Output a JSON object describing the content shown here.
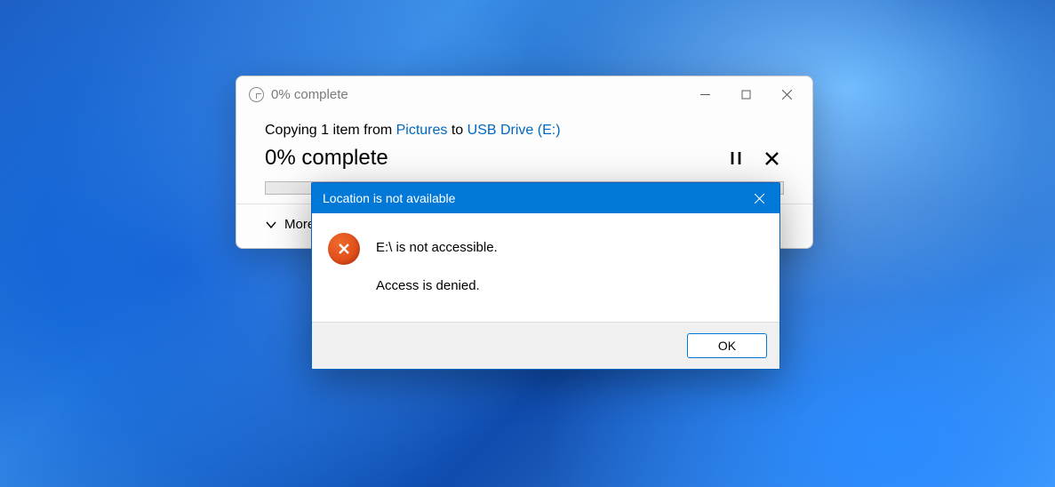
{
  "copy_window": {
    "title": "0% complete",
    "copy_text_prefix": "Copying 1 item from ",
    "copy_source": "Pictures",
    "copy_mid": " to ",
    "copy_dest": "USB Drive (E:)",
    "percent_line": "0% complete",
    "details_label": "More details",
    "progress_percent": 0
  },
  "error_dialog": {
    "title": "Location is not available",
    "line1": "E:\\ is not accessible.",
    "line2": "Access is denied.",
    "ok_label": "OK"
  },
  "colors": {
    "accent": "#0078d7",
    "link": "#0067c0",
    "error_icon": "#d83c0f"
  }
}
